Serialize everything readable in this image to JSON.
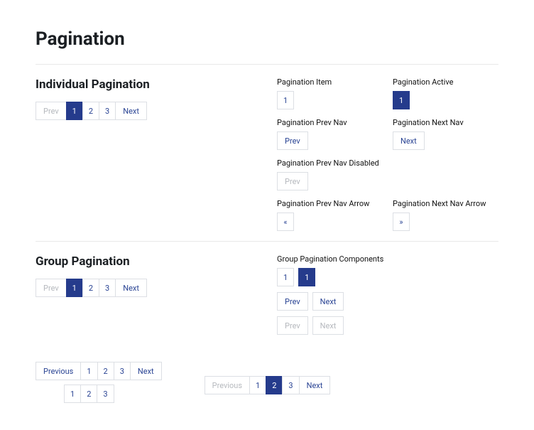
{
  "page": {
    "title": "Pagination"
  },
  "section1": {
    "title": "Individual Pagination",
    "pager": {
      "prev": "Prev",
      "p1": "1",
      "p2": "2",
      "p3": "3",
      "next": "Next"
    },
    "variants": {
      "item": {
        "label": "Pagination Item",
        "value": "1"
      },
      "active": {
        "label": "Pagination Active",
        "value": "1"
      },
      "prevnav": {
        "label": "Pagination Prev Nav",
        "value": "Prev"
      },
      "nextnav": {
        "label": "Pagination Next Nav",
        "value": "Next"
      },
      "prevdisabled": {
        "label": "Pagination Prev Nav Disabled",
        "value": "Prev"
      },
      "prevarrow": {
        "label": "Pagination Prev Nav Arrow",
        "value": "«"
      },
      "nextarrow": {
        "label": "Pagination Next Nav Arrow",
        "value": "»"
      }
    }
  },
  "section2": {
    "title": "Group Pagination",
    "pager": {
      "prev": "Prev",
      "p1": "1",
      "p2": "2",
      "p3": "3",
      "next": "Next"
    },
    "groupLabel": "Group Pagination Components",
    "group": {
      "p1": "1",
      "p1active": "1",
      "prev": "Prev",
      "next": "Next",
      "prevDisabled": "Prev",
      "nextDisabled": "Next"
    }
  },
  "footer": {
    "full": {
      "previous": "Previous",
      "p1": "1",
      "p2": "2",
      "p3": "3",
      "next": "Next"
    },
    "numbers": {
      "p1": "1",
      "p2": "2",
      "p3": "3"
    },
    "active2": {
      "previous": "Previous",
      "p1": "1",
      "p2": "2",
      "p3": "3",
      "next": "Next"
    }
  }
}
